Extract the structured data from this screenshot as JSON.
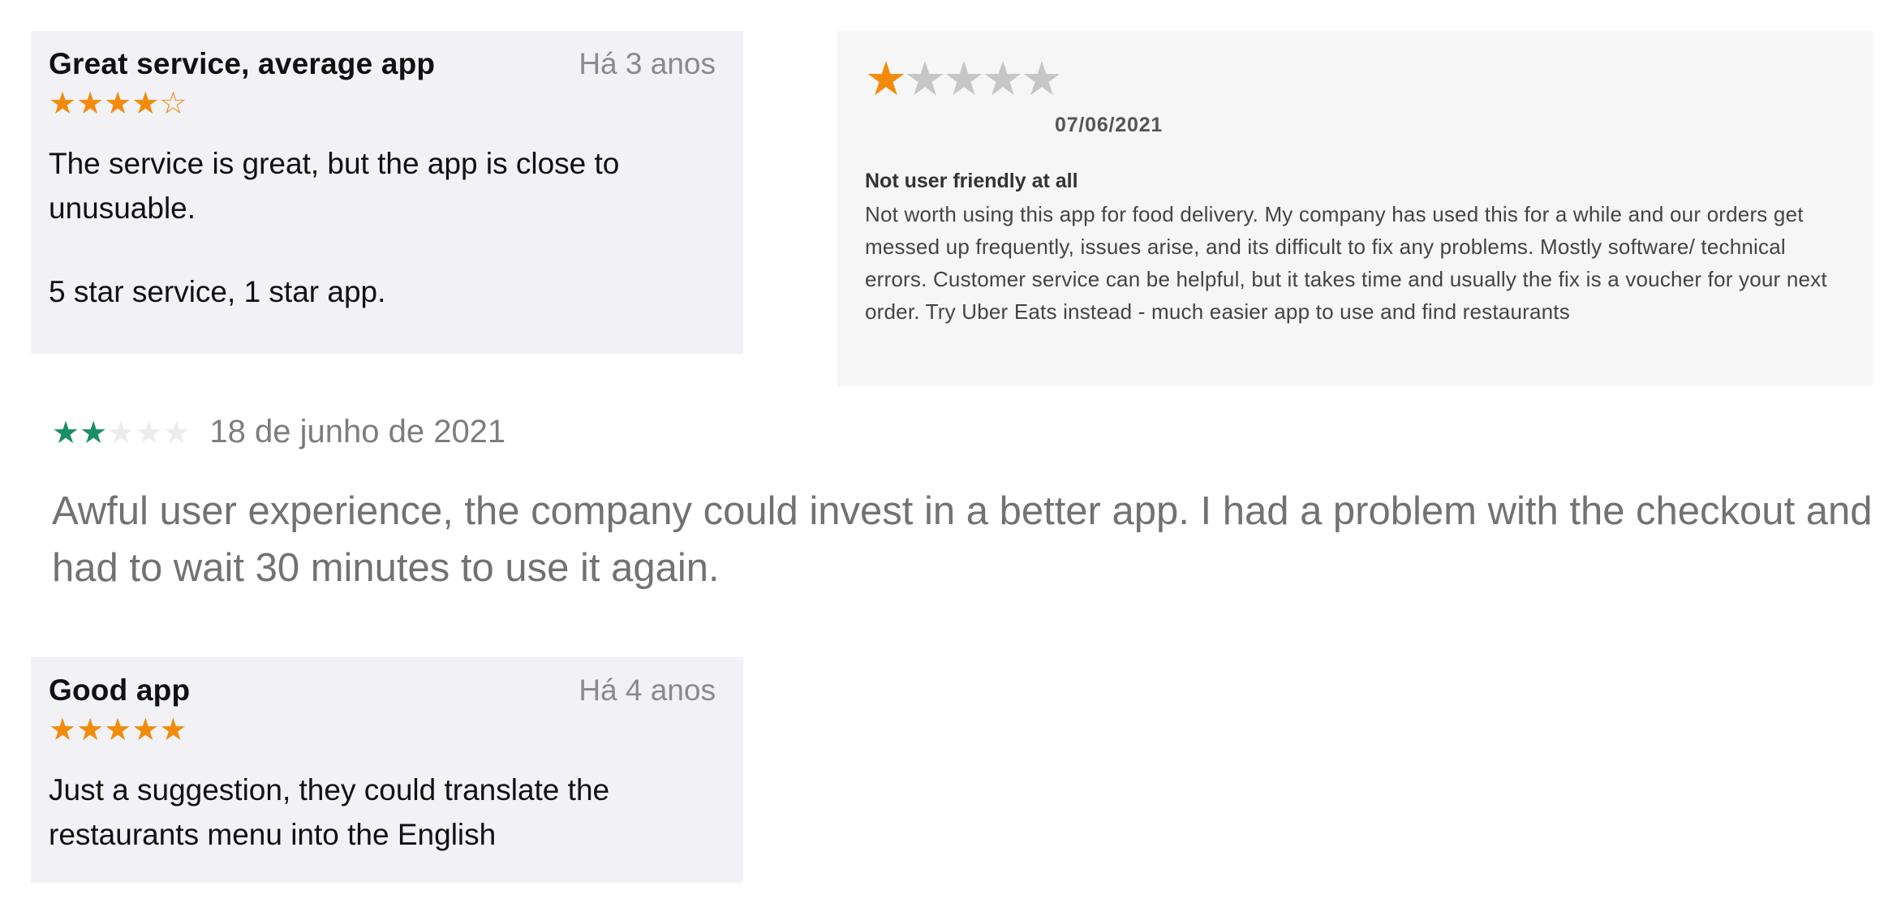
{
  "review_1": {
    "title": "Great service, average app",
    "age": "Há 3 anos",
    "rating": 4,
    "stars": [
      "★",
      "★",
      "★",
      "★",
      "☆"
    ],
    "body_line_1": "The service is great, but the app is close to unusuable.",
    "body_line_2": "5 star service, 1 star app.",
    "star_color": "#f38b0a"
  },
  "review_2": {
    "rating": 1,
    "stars": [
      "★",
      "★",
      "★",
      "★",
      "★"
    ],
    "date": "07/06/2021",
    "title": "Not user friendly at all",
    "body": "Not worth using this app for food delivery. My company has used this for a while and our orders get messed up frequently, issues arise, and its difficult to fix any problems. Mostly software/ technical errors. Customer service can be helpful, but it takes time and usually the fix is a voucher for your next order. Try Uber Eats instead - much easier app to use and find restaurants",
    "star_color": "#f38b0a",
    "star_off_color": "#c6c6c6"
  },
  "review_3": {
    "rating": 2,
    "stars": [
      "★",
      "★",
      "★",
      "★",
      "★"
    ],
    "date": "18 de junho de 2021",
    "body": "Awful user experience, the company could invest in a better app. I had a problem with the checkout and had to wait 30 minutes to use it again.",
    "star_color": "#1a8f64",
    "star_off_color": "#ececec"
  },
  "review_4": {
    "title": "Good app",
    "age": "Há 4 anos",
    "rating": 5,
    "stars": [
      "★",
      "★",
      "★",
      "★",
      "★"
    ],
    "body": "Just a suggestion, they could translate the restaurants menu into the English",
    "star_color": "#f38b0a"
  }
}
